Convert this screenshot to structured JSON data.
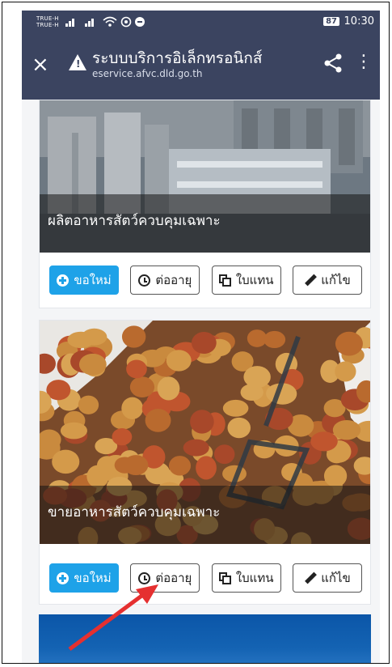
{
  "status_bar": {
    "carrier_line1": "TRUE-H",
    "carrier_line2": "TRUE-H",
    "battery": "87",
    "time": "10:30"
  },
  "app_bar": {
    "title": "ระบบบริการอิเล็กทรอนิกส์",
    "url": "eservice.afvc.dld.go.th",
    "warning_symbol": "!",
    "close_symbol": "×",
    "menu_symbol": "⋮"
  },
  "cards": [
    {
      "title": "ผลิตอาหารสัตว์ควบคุมเฉพาะ",
      "image_icon": "feed-factory-image",
      "buttons": {
        "new": "ขอใหม่",
        "renew": "ต่ออายุ",
        "replace": "ใบแทน",
        "edit": "แก้ไข"
      }
    },
    {
      "title": "ขายอาหารสัตว์ควบคุมเฉพาะ",
      "image_icon": "pet-food-kibble-image",
      "buttons": {
        "new": "ขอใหม่",
        "renew": "ต่ออายุ",
        "replace": "ใบแทน",
        "edit": "แก้ไข"
      }
    }
  ],
  "colors": {
    "header": "#3b4460",
    "primary_button": "#1ea2e8",
    "annotation_arrow": "#e53030"
  }
}
